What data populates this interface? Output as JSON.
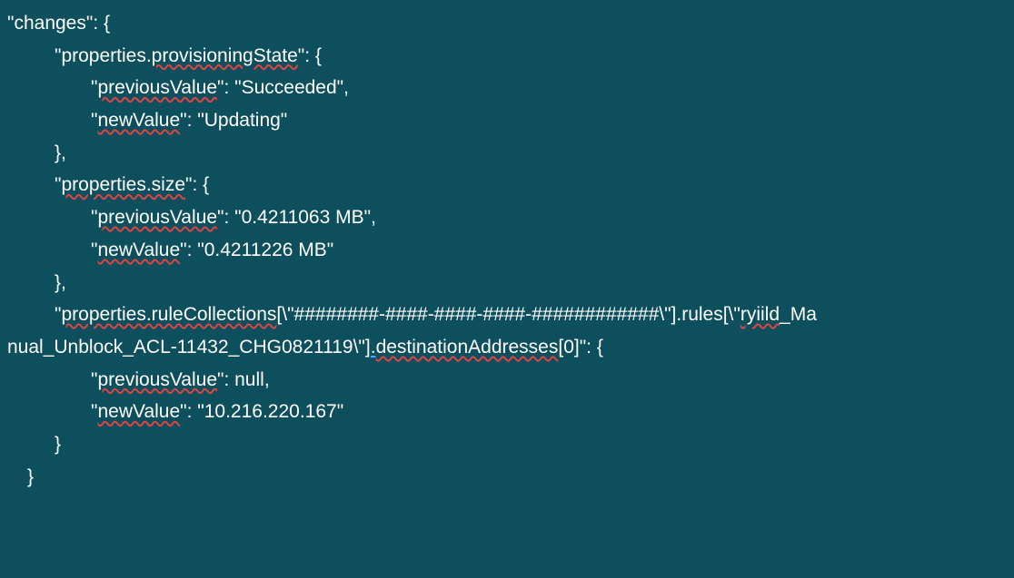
{
  "json": {
    "root_key": "changes",
    "entries": [
      {
        "key": "properties.provisioningState",
        "key_misspelled_parts": [
          "provisioningState"
        ],
        "previousValue": "\"Succeeded\"",
        "newValue": "\"Updating\""
      },
      {
        "key": "properties.size",
        "key_misspelled_parts": [
          "properties.size"
        ],
        "previousValue": "\"0.4211063 MB\"",
        "newValue": "\"0.4211226 MB\""
      },
      {
        "key": "properties.ruleCollections[\\\"########-####-####-####-############\\\"].rules[\\\"ryiild_Manual_Unblock_ACL-11432_CHG0821119\\\"].destinationAddresses[0]",
        "key_misspelled_parts": [
          "properties.ruleCollections",
          "ryiild",
          "destinationAddresses"
        ],
        "previousValue": "null",
        "newValue": "\"10.216.220.167\""
      }
    ],
    "labels": {
      "previousValue": "previousValue",
      "newValue": "newValue"
    }
  }
}
